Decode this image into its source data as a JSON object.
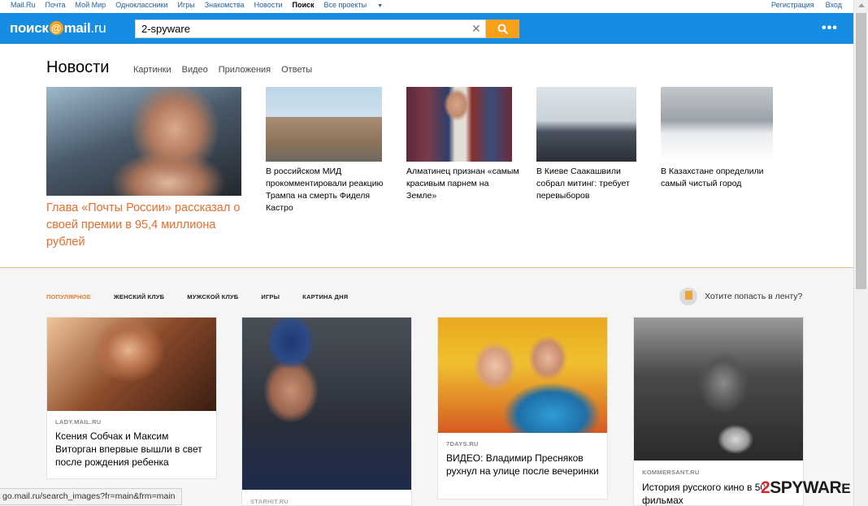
{
  "topnav": {
    "links": [
      "Mail.Ru",
      "Почта",
      "Мой Мир",
      "Одноклассники",
      "Игры",
      "Знакомства",
      "Новости",
      "Поиск",
      "Все проекты"
    ],
    "right": [
      "Регистрация",
      "Вход"
    ]
  },
  "logo": {
    "part1": "поиск",
    "at": "@",
    "part2": "mail",
    "part3": ".ru"
  },
  "search": {
    "value": "2-spyware",
    "clear": "✕"
  },
  "more": "•••",
  "news": {
    "title": "Новости",
    "tabs": [
      "Картинки",
      "Видео",
      "Приложения",
      "Ответы"
    ],
    "main_caption": "Глава «Почты России» рассказал о своей премии в 95,4 миллиона рублей",
    "items": [
      "В российском МИД прокомментировали реакцию Трампа на смерть Фиделя Кастро",
      "Алматинец признан «самым красивым парнем на Земле»",
      "В Киеве Саакашвили собрал митинг: требует перевыборов",
      "В Казахстане определили самый чистый город"
    ]
  },
  "feed": {
    "tabs": [
      "ПОПУЛЯРНОЕ",
      "ЖЕНСКИЙ КЛУБ",
      "МУЖСКОЙ КЛУБ",
      "ИГРЫ",
      "КАРТИНА ДНЯ"
    ],
    "promo": "Хотите попасть в ленту?",
    "cards": [
      {
        "source": "LADY.MAIL.RU",
        "title": "Ксения Собчак и Максим Виторган впервые вышли в свет после рождения ребенка"
      },
      {
        "source": "STARHIT.RU",
        "title": ""
      },
      {
        "source": "7DAYS.RU",
        "title": "ВИДЕО: Владимир Пресняков рухнул на улице после вечеринки"
      },
      {
        "source": "KOMMERSANT.RU",
        "title": "История русского кино в 50 фильмах"
      }
    ]
  },
  "status_url": "go.mail.ru/search_images?fr=main&frm=main",
  "watermark": {
    "two": "2",
    "rest": "SPYWAR",
    "s": "E"
  },
  "colors": {
    "header_blue": "#168de2",
    "accent_orange": "#f7a01a",
    "headline_orange": "#f06b2a"
  }
}
